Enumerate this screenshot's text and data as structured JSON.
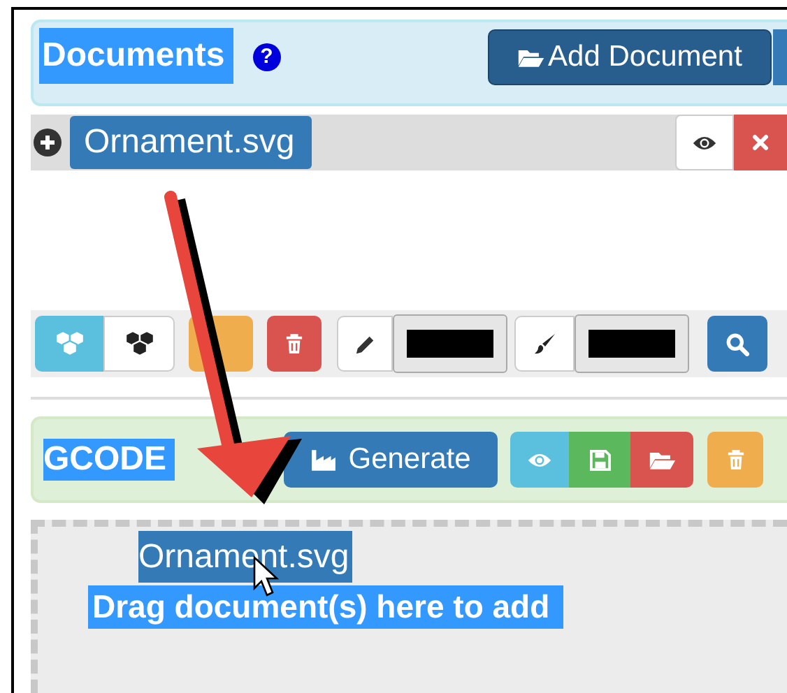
{
  "documents_panel": {
    "title": "Documents",
    "title_highlighted": true,
    "help_icon": "?",
    "add_button": "Add Document"
  },
  "document_items": [
    {
      "name": "Ornament.svg",
      "expanded": false
    }
  ],
  "gcode_panel": {
    "title": "GCODE",
    "title_highlighted": true,
    "generate_button": "Generate"
  },
  "drop_zone": {
    "dragged_item": "Ornament.svg",
    "hint": "Drag document(s) here to add",
    "hint_highlighted": true
  }
}
